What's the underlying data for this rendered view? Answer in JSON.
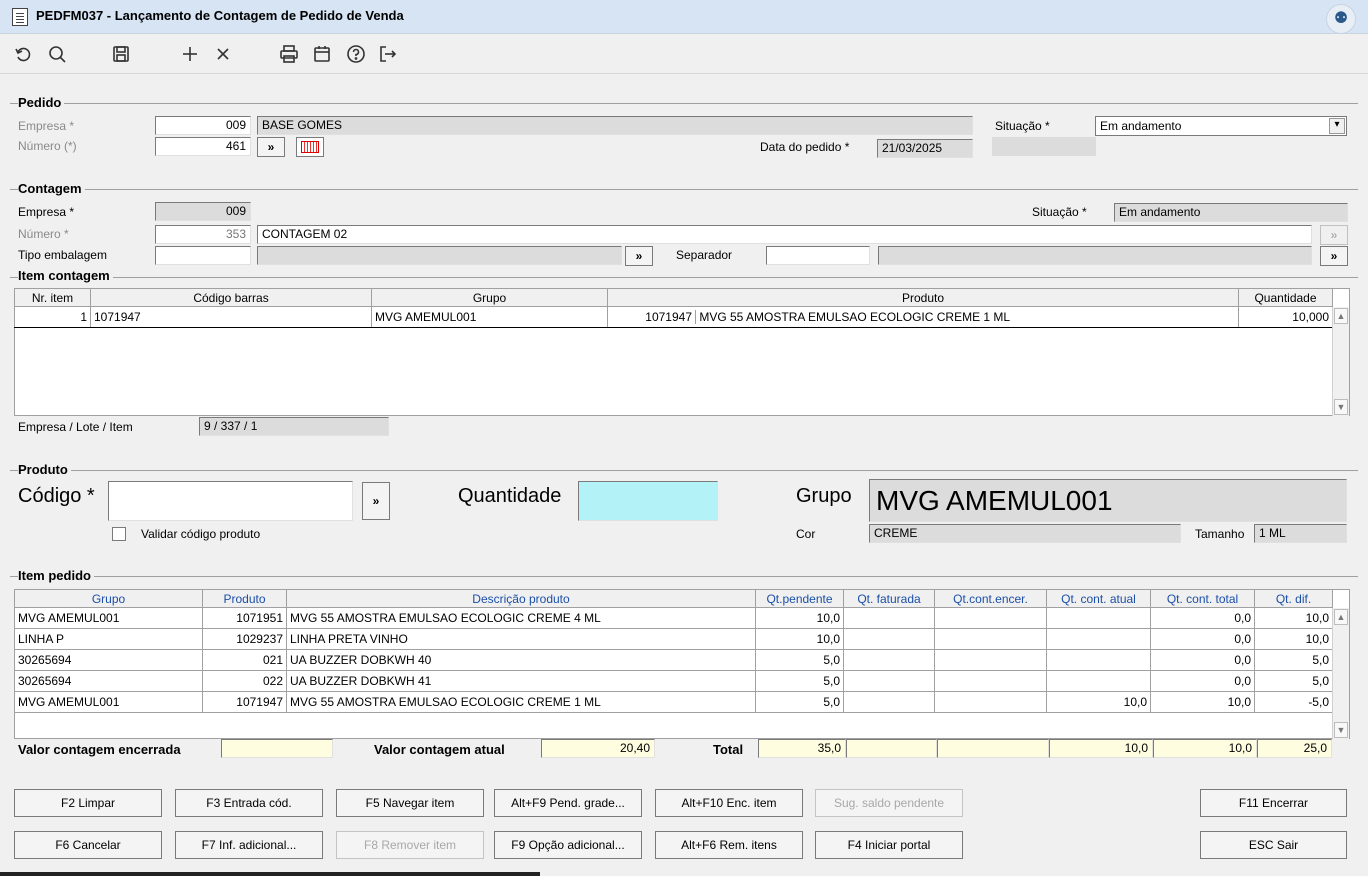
{
  "window": {
    "title": "PEDFM037 - Lançamento de Contagem de Pedido de Venda"
  },
  "toolbar": {
    "icons": [
      "undo-icon",
      "search-icon",
      "save-icon",
      "add-icon",
      "delete-icon",
      "print-icon",
      "calendar-icon",
      "help-icon",
      "exit-icon"
    ]
  },
  "pedido": {
    "group_label": "Pedido",
    "empresa_label": "Empresa *",
    "empresa_code": "009",
    "empresa_name": "BASE GOMES",
    "numero_label": "Número (*)",
    "numero": "461",
    "lookup_button": "»",
    "situacao_label": "Situação *",
    "situacao_value": "Em andamento",
    "data_label": "Data do pedido *",
    "data_value": "21/03/2025"
  },
  "contagem": {
    "group_label": "Contagem",
    "empresa_label": "Empresa *",
    "empresa_code": "009",
    "situacao_label": "Situação *",
    "situacao_value": "Em andamento",
    "numero_label": "Número *",
    "numero": "353",
    "descricao": "CONTAGEM 02",
    "tipo_label": "Tipo embalagem",
    "lookup_button": "»",
    "separador_label": "Separador"
  },
  "item_contagem": {
    "group_label": "Item contagem",
    "columns": [
      "Nr. item",
      "Código barras",
      "Grupo",
      "Produto",
      "Quantidade"
    ],
    "rows": [
      {
        "nr": "1",
        "codigo": "1071947",
        "grupo": "MVG AMEMUL001",
        "produto_code": "1071947",
        "produto_desc": "MVG 55 AMOSTRA EMULSAO ECOLOGIC CREME 1 ML",
        "quantidade": "10,000"
      }
    ],
    "lote_label": "Empresa / Lote / Item",
    "lote_value": "9 / 337 / 1"
  },
  "produto": {
    "group_label": "Produto",
    "codigo_label": "Código *",
    "codigo_value": "",
    "lookup_button": "»",
    "validar_label": "Validar código produto",
    "quantidade_label": "Quantidade",
    "quantidade_value": "",
    "grupo_label": "Grupo",
    "grupo_value": "MVG AMEMUL001",
    "cor_label": "Cor",
    "cor_value": "CREME",
    "tamanho_label": "Tamanho",
    "tamanho_value": "1 ML"
  },
  "item_pedido": {
    "group_label": "Item pedido",
    "columns": [
      "Grupo",
      "Produto",
      "Descrição produto",
      "Qt.pendente",
      "Qt. faturada",
      "Qt.cont.encer.",
      "Qt. cont. atual",
      "Qt. cont. total",
      "Qt. dif."
    ],
    "rows": [
      {
        "grupo": "MVG AMEMUL001",
        "produto": "1071951",
        "descricao": "MVG 55 AMOSTRA EMULSAO ECOLOGIC CREME 4 ML",
        "pendente": "10,0",
        "faturada": "",
        "encer": "",
        "atual": "",
        "total": "0,0",
        "dif": "10,0"
      },
      {
        "grupo": "LINHA P",
        "produto": "1029237",
        "descricao": "LINHA PRETA VINHO",
        "pendente": "10,0",
        "faturada": "",
        "encer": "",
        "atual": "",
        "total": "0,0",
        "dif": "10,0"
      },
      {
        "grupo": "30265694",
        "produto": "021",
        "descricao": "UA BUZZER DOBKWH 40",
        "pendente": "5,0",
        "faturada": "",
        "encer": "",
        "atual": "",
        "total": "0,0",
        "dif": "5,0"
      },
      {
        "grupo": "30265694",
        "produto": "022",
        "descricao": "UA BUZZER DOBKWH 41",
        "pendente": "5,0",
        "faturada": "",
        "encer": "",
        "atual": "",
        "total": "0,0",
        "dif": "5,0"
      },
      {
        "grupo": "MVG AMEMUL001",
        "produto": "1071947",
        "descricao": "MVG 55 AMOSTRA EMULSAO ECOLOGIC CREME 1 ML",
        "pendente": "5,0",
        "faturada": "",
        "encer": "",
        "atual": "10,0",
        "total": "10,0",
        "dif": "-5,0"
      }
    ]
  },
  "totais": {
    "encerrada_label": "Valor contagem encerrada",
    "encerrada_value": "",
    "atual_label": "Valor contagem atual",
    "atual_value": "20,40",
    "total_label": "Total",
    "pendente": "35,0",
    "faturada": "",
    "encer": "",
    "atual": "10,0",
    "total": "10,0",
    "dif": "25,0"
  },
  "buttons": {
    "row1": [
      {
        "label": "F2 Limpar",
        "enabled": true
      },
      {
        "label": "F3 Entrada cód.",
        "enabled": true
      },
      {
        "label": "F5 Navegar item",
        "enabled": true
      },
      {
        "label": "Alt+F9 Pend. grade...",
        "enabled": true
      },
      {
        "label": "Alt+F10 Enc. item",
        "enabled": true
      },
      {
        "label": "Sug. saldo pendente",
        "enabled": false
      }
    ],
    "row2": [
      {
        "label": "F6 Cancelar",
        "enabled": true
      },
      {
        "label": "F7 Inf. adicional...",
        "enabled": true
      },
      {
        "label": "F8 Remover item",
        "enabled": false
      },
      {
        "label": "F9 Opção adicional...",
        "enabled": true
      },
      {
        "label": "Alt+F6 Rem. itens",
        "enabled": true
      },
      {
        "label": "F4 Iniciar portal",
        "enabled": true
      }
    ],
    "encerrar": "F11 Encerrar",
    "sair": "ESC Sair"
  }
}
